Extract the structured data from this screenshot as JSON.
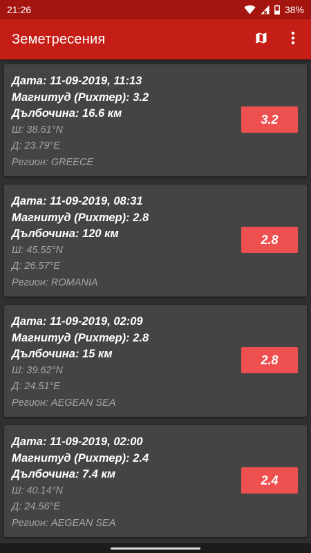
{
  "status": {
    "time": "21:26",
    "battery": "38%"
  },
  "appbar": {
    "title": "Земетресения",
    "map_icon": "map-icon",
    "more_icon": "more-vert-icon"
  },
  "colors": {
    "appbar": "#c41e16",
    "statusbar": "#a5150f",
    "card": "#444444",
    "badge": "#ee4f4f",
    "background": "#303030"
  },
  "quakes": [
    {
      "date": "Дата: 11-09-2019, 11:13",
      "magnitude": "Магнитуд (Рихтер): 3.2",
      "depth": "Дълбочина: 16.6 км",
      "lat": "Ш: 38.61°N",
      "lon": "Д: 23.79°E",
      "region": "Регион: GREECE",
      "badge": "3.2"
    },
    {
      "date": "Дата: 11-09-2019, 08:31",
      "magnitude": "Магнитуд (Рихтер): 2.8",
      "depth": "Дълбочина: 120 км",
      "lat": "Ш: 45.55°N",
      "lon": "Д: 26.57°E",
      "region": "Регион: ROMANIA",
      "badge": "2.8"
    },
    {
      "date": "Дата: 11-09-2019, 02:09",
      "magnitude": "Магнитуд (Рихтер): 2.8",
      "depth": "Дълбочина: 15 км",
      "lat": "Ш: 39.62°N",
      "lon": "Д: 24.51°E",
      "region": "Регион: AEGEAN SEA",
      "badge": "2.8"
    },
    {
      "date": "Дата: 11-09-2019, 02:00",
      "magnitude": "Магнитуд (Рихтер): 2.4",
      "depth": "Дълбочина: 7.4 км",
      "lat": "Ш: 40.14°N",
      "lon": "Д: 24.56°E",
      "region": "Регион: AEGEAN SEA",
      "badge": "2.4"
    }
  ]
}
